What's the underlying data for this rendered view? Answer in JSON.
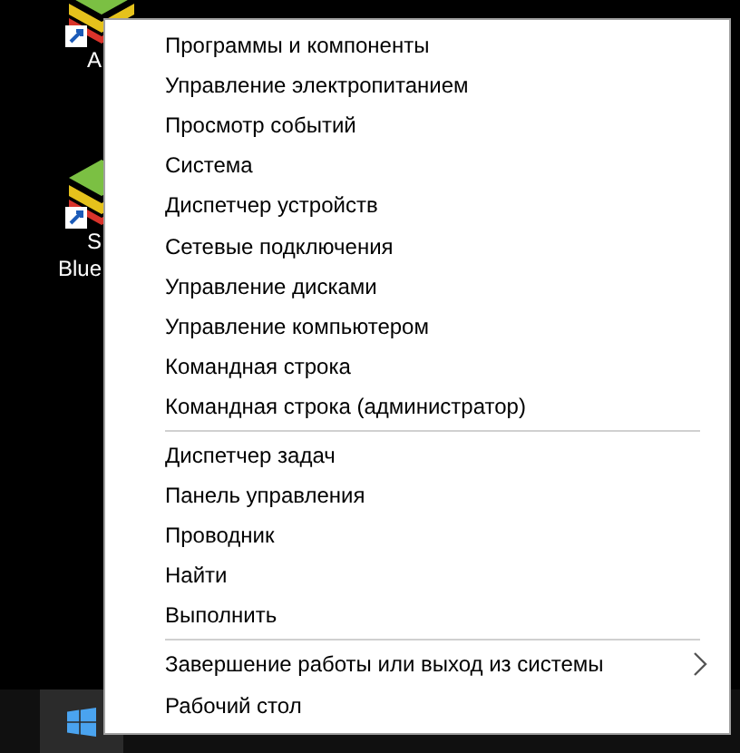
{
  "desktop_icons": [
    {
      "label_lines": [
        "A"
      ]
    },
    {
      "label_lines": [
        "S",
        "Blue"
      ]
    }
  ],
  "menu": {
    "groups": [
      {
        "items": [
          {
            "label": "Программы и компоненты",
            "submenu": false
          },
          {
            "label": "Управление электропитанием",
            "submenu": false
          },
          {
            "label": "Просмотр событий",
            "submenu": false
          },
          {
            "label": "Система",
            "submenu": false
          },
          {
            "label": "Диспетчер устройств",
            "submenu": false
          },
          {
            "label": "Сетевые подключения",
            "submenu": false
          },
          {
            "label": "Управление дисками",
            "submenu": false
          },
          {
            "label": "Управление компьютером",
            "submenu": false
          },
          {
            "label": "Командная строка",
            "submenu": false
          },
          {
            "label": "Командная строка (администратор)",
            "submenu": false
          }
        ]
      },
      {
        "items": [
          {
            "label": "Диспетчер задач",
            "submenu": false
          },
          {
            "label": "Панель управления",
            "submenu": false
          },
          {
            "label": "Проводник",
            "submenu": false
          },
          {
            "label": "Найти",
            "submenu": false
          },
          {
            "label": "Выполнить",
            "submenu": false
          }
        ]
      },
      {
        "items": [
          {
            "label": "Завершение работы или выход из системы",
            "submenu": true
          },
          {
            "label": "Рабочий стол",
            "submenu": false
          }
        ]
      }
    ]
  },
  "taskbar": {
    "start_selected": true
  }
}
